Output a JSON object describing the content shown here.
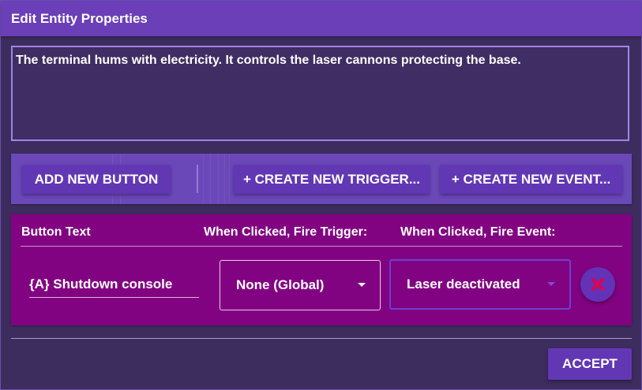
{
  "dialog": {
    "title": "Edit Entity Properties",
    "description": "The terminal hums with electricity. It controls the laser cannons protecting the base."
  },
  "toolbar": {
    "add_button_label": "ADD NEW BUTTON",
    "create_trigger_label": "+ CREATE NEW TRIGGER...",
    "create_event_label": "+ CREATE NEW EVENT..."
  },
  "buttons_table": {
    "columns": [
      "Button Text",
      "When Clicked, Fire Trigger:",
      "When Clicked, Fire Event:"
    ],
    "rows": [
      {
        "button_text": "{A} Shutdown console",
        "trigger": "None (Global)",
        "event": "Laser deactivated"
      }
    ]
  },
  "footer": {
    "accept_label": "ACCEPT"
  },
  "icons": {
    "delete": "close-icon"
  },
  "colors": {
    "titlebar": "#6a3fb8",
    "background": "#3d2d5f",
    "panel": "#820381",
    "button": "#6237b4",
    "delete_x": "#e0004f"
  }
}
